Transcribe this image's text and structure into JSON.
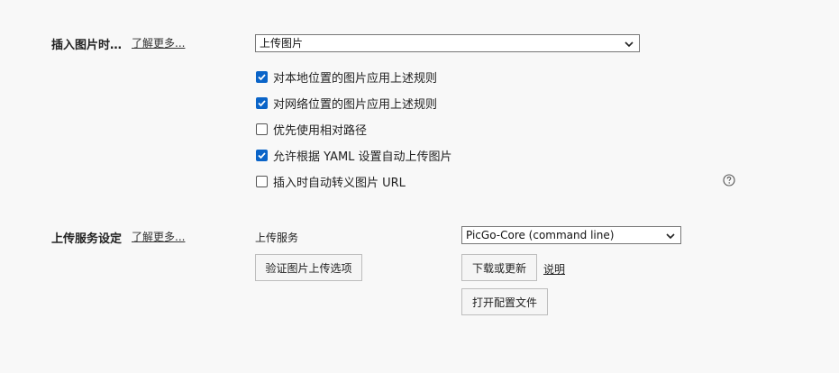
{
  "insert_image": {
    "title": "插入图片时…",
    "learn_more": "了解更多...",
    "action_select": "上传图片",
    "options": [
      {
        "label": "对本地位置的图片应用上述规则",
        "checked": true
      },
      {
        "label": "对网络位置的图片应用上述规则",
        "checked": true
      },
      {
        "label": "优先使用相对路径",
        "checked": false
      },
      {
        "label": "允许根据 YAML 设置自动上传图片",
        "checked": true
      },
      {
        "label": "插入时自动转义图片 URL",
        "checked": false
      }
    ]
  },
  "upload_service": {
    "title": "上传服务设定",
    "learn_more": "了解更多...",
    "service_label": "上传服务",
    "service_select": "PicGo-Core (command line)",
    "verify_button": "验证图片上传选项",
    "download_button": "下载或更新",
    "docs_link": "说明",
    "open_config_button": "打开配置文件"
  },
  "colors": {
    "accent": "#0a64c8",
    "background": "#f8f8f8"
  },
  "icons": {
    "help": "question-circle-icon",
    "select_arrow": "chevron-down-icon",
    "check": "check-icon"
  }
}
